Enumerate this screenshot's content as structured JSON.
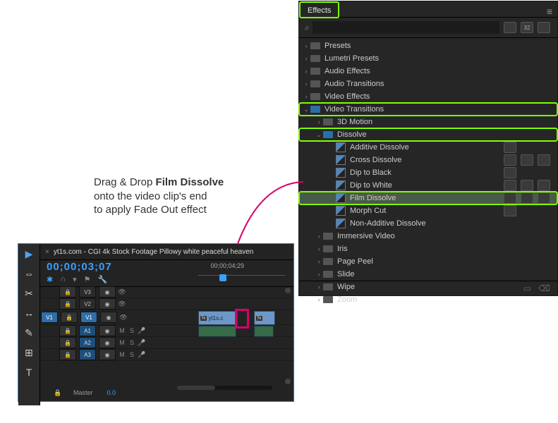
{
  "effects": {
    "tab": "Effects",
    "search_placeholder": "",
    "badge_labels": [
      "",
      "32",
      ""
    ],
    "root": [
      {
        "label": "Presets",
        "type": "folder",
        "indent": 0,
        "expanded": false
      },
      {
        "label": "Lumetri Presets",
        "type": "folder",
        "indent": 0,
        "expanded": false
      },
      {
        "label": "Audio Effects",
        "type": "folder",
        "indent": 0,
        "expanded": false
      },
      {
        "label": "Audio Transitions",
        "type": "folder",
        "indent": 0,
        "expanded": false
      },
      {
        "label": "Video Effects",
        "type": "folder",
        "indent": 0,
        "expanded": false
      },
      {
        "label": "Video Transitions",
        "type": "folder",
        "indent": 0,
        "expanded": true,
        "highlight": true,
        "blue": true
      },
      {
        "label": "3D Motion",
        "type": "folder",
        "indent": 1,
        "expanded": false
      },
      {
        "label": "Dissolve",
        "type": "folder",
        "indent": 1,
        "expanded": true,
        "highlight": true,
        "blue": true
      },
      {
        "label": "Additive Dissolve",
        "type": "preset",
        "indent": 2,
        "tags": [
          1,
          0,
          0
        ]
      },
      {
        "label": "Cross Dissolve",
        "type": "preset",
        "indent": 2,
        "tags": [
          1,
          1,
          1
        ]
      },
      {
        "label": "Dip to Black",
        "type": "preset",
        "indent": 2,
        "tags": [
          1,
          0,
          0
        ]
      },
      {
        "label": "Dip to White",
        "type": "preset",
        "indent": 2,
        "tags": [
          1,
          1,
          1
        ]
      },
      {
        "label": "Film Dissolve",
        "type": "preset",
        "indent": 2,
        "tags": [
          1,
          1,
          1
        ],
        "selected": true,
        "highlight": true
      },
      {
        "label": "Morph Cut",
        "type": "preset",
        "indent": 2,
        "tags": [
          1,
          0,
          0
        ]
      },
      {
        "label": "Non-Additive Dissolve",
        "type": "preset",
        "indent": 2,
        "tags": [
          0,
          0,
          0
        ]
      },
      {
        "label": "Immersive Video",
        "type": "folder",
        "indent": 1,
        "expanded": false
      },
      {
        "label": "Iris",
        "type": "folder",
        "indent": 1,
        "expanded": false
      },
      {
        "label": "Page Peel",
        "type": "folder",
        "indent": 1,
        "expanded": false
      },
      {
        "label": "Slide",
        "type": "folder",
        "indent": 1,
        "expanded": false
      },
      {
        "label": "Wipe",
        "type": "folder",
        "indent": 1,
        "expanded": false
      },
      {
        "label": "Zoom",
        "type": "folder",
        "indent": 1,
        "expanded": false
      }
    ]
  },
  "instruction": {
    "pre": "Drag & Drop ",
    "bold": "Film Dissolve",
    "line2": "onto the video clip's end",
    "line3": "to apply Fade Out effect"
  },
  "timeline": {
    "sequence_tab": "yt1s.com -  CGI 4k Stock Footage  Pillowy white peaceful heaven",
    "timecode": "00;00;03;07",
    "ruler_time": "00;00;04;29",
    "tools": [
      "▶",
      "⇔",
      "✂",
      "↔",
      "✎",
      "⊞",
      "T"
    ],
    "headers": {
      "v3": "V3",
      "v2": "V2",
      "v1": "V1",
      "src_v1": "V1",
      "a1": "A1",
      "a2": "A2",
      "a3": "A3",
      "mute": "M",
      "solo": "S",
      "lock": "🔒",
      "eye": "👁",
      "toggle": "◉",
      "mic": "🎤"
    },
    "clip_label": "yt1s.c",
    "clip_fx": "fx",
    "master_label": "Master",
    "master_value": "0.0"
  }
}
